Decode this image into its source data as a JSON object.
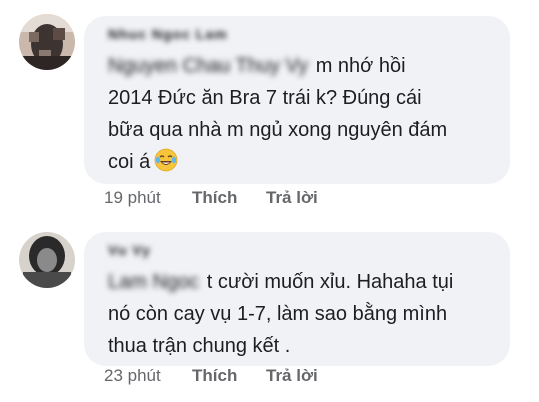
{
  "comments": [
    {
      "author": "Nhuc Ngoc Lam",
      "mention": "Nguyen Chau Thuy Vy",
      "text": "m nhớ hồi 2014 Đức ăn Bra 7 trái k? Đúng cái bữa qua nhà m ngủ xong nguyên đám coi á",
      "line1": "m nhớ hồi",
      "line2": "2014 Đức ăn Bra 7 trái k? Đúng cái",
      "line3": "bữa qua nhà m ngủ xong nguyên đám",
      "line4": "coi á",
      "emoji": "tears-of-joy-emoji",
      "time": "19 phút",
      "like": "Thích",
      "reply": "Trả lời",
      "avatar_colors": [
        "#3d3330",
        "#7a6a62",
        "#c9b8ab"
      ]
    },
    {
      "author": "Vu Vy",
      "mention": "Lam Ngoc",
      "line1": "t cười muốn xỉu. Hahaha tụi",
      "line2": "nó còn cay vụ 1-7, làm sao bằng mình",
      "line3": "thua trận chung kết .",
      "time": "23 phút",
      "like": "Thích",
      "reply": "Trả lời",
      "avatar_colors": [
        "#2a2a2a",
        "#8a8a8a",
        "#d8d2cc"
      ]
    }
  ],
  "colors": {
    "bubble": "#f0f2f5",
    "text": "#1c1e21",
    "meta": "#65676b"
  }
}
